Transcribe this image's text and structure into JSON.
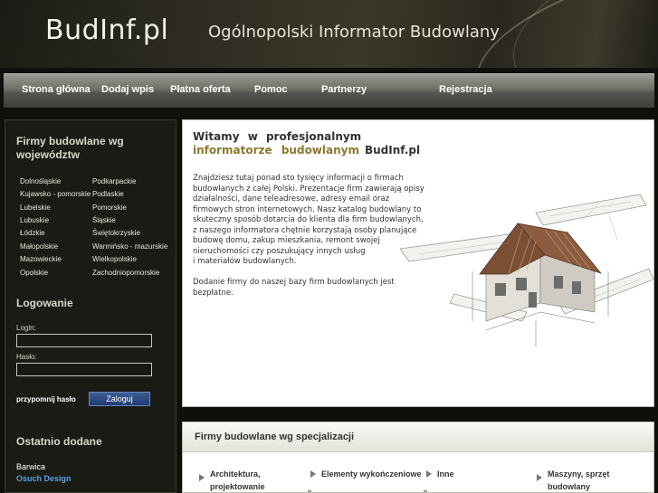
{
  "header": {
    "logo": "BudInf.pl",
    "slogan": "Ogólnopolski Informator Budowlany"
  },
  "nav": {
    "items": [
      {
        "label": "Strona główna"
      },
      {
        "label": "Dodaj wpis"
      },
      {
        "label": "Płatna oferta"
      },
      {
        "label": "Pomoc"
      },
      {
        "label": "Partnerzy"
      },
      {
        "label": "Rejestracja"
      }
    ]
  },
  "sidebar": {
    "regions_title_line1": "Firmy budowlane wg",
    "regions_title_line2": "województw",
    "regions": [
      "Dolnośląskie",
      "Podkarpackie",
      "Kujawsko - pomorskie",
      "Podlaskie",
      "Lubelskie",
      "Pomorskie",
      "Lubuskie",
      "Śląskie",
      "Łódzkie",
      "Świętokrzyskie",
      "Małopolskie",
      "Warmińsko - mazurskie",
      "Mazowieckie",
      "Wielkopolskie",
      "Opolskie",
      "Zachodniopomorskie"
    ],
    "login_title": "Logowanie",
    "login_label": "Login:",
    "password_label": "Hasło:",
    "login_value": "",
    "password_value": "",
    "remind_label": "przypomnij hasło",
    "login_button": "Zaloguj",
    "recent_title": "Ostatnio dodane",
    "recent": [
      {
        "name": "Barwica",
        "color": "#ffffff"
      },
      {
        "name": "Osuch Design",
        "color": "#5aa0e0"
      }
    ]
  },
  "welcome": {
    "line1": "Witamy w profesjonalnym",
    "line2_highlight": "informatorze budowlanym",
    "line2_brand": "BudInf.pl",
    "text_lines": [
      "Znajdziesz tutaj ponad sto tysięcy informacji o firmach",
      "budowlanych z całej Polski. Prezentacje firm zawierają opisy",
      "działalności, dane teleadresowe, adresy email oraz",
      "firmowych stron internetowych. Nasz katalog budowlany to",
      "skuteczny sposób dotarcia do klienta dla firm budowlanych,",
      "z naszego informatora chętnie korzystają osoby planujące",
      "budowę domu, zakup mieszkania, remont swojej",
      "nieruchomości czy poszukujący innych usług",
      "i materiałów budowlanych."
    ],
    "text2_lines": [
      "Dodanie firmy do naszej bazy firm budowlanych jest",
      "bezpłatne."
    ]
  },
  "specializations": {
    "title": "Firmy budowlane wg specjalizacji",
    "categories": [
      {
        "line1": "Architektura,",
        "line2": "projektowanie"
      },
      {
        "line1": "Elementy wykończeniowe",
        "line2": ""
      },
      {
        "line1": "Inne",
        "line2": ""
      },
      {
        "line1": "Maszyny, sprzęt",
        "line2": "budowlany"
      }
    ]
  },
  "colors": {
    "accent_gold": "#8a7a2e",
    "button_blue": "#1f3d73",
    "recent_link": "#5aa0e0"
  }
}
